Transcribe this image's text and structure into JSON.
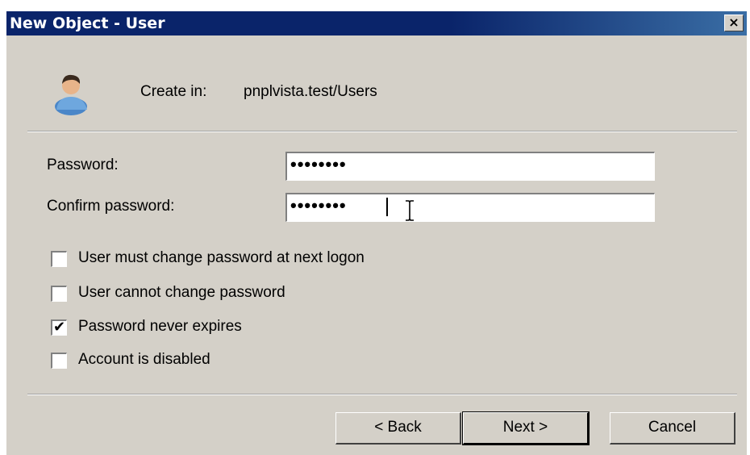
{
  "window": {
    "title": "New Object - User",
    "close_glyph": "×",
    "close_icon": "close-icon"
  },
  "header": {
    "icon": "user-icon",
    "create_in_label": "Create in:",
    "create_in_path": "pnplvista.test/Users"
  },
  "fields": {
    "password_label": "Password:",
    "password_value": "••••••••",
    "confirm_label": "Confirm password:",
    "confirm_value": "••••••••"
  },
  "options": [
    {
      "label": "User must change password at next logon",
      "checked": false
    },
    {
      "label": "User cannot change password",
      "checked": false
    },
    {
      "label": "Password never expires",
      "checked": true
    },
    {
      "label": "Account is disabled",
      "checked": false
    }
  ],
  "check_glyph": "✔",
  "buttons": {
    "back": "< Back",
    "next": "Next >",
    "cancel": "Cancel"
  },
  "colors": {
    "titlebar": "#0a246a",
    "dialog_bg": "#d4d0c8"
  }
}
